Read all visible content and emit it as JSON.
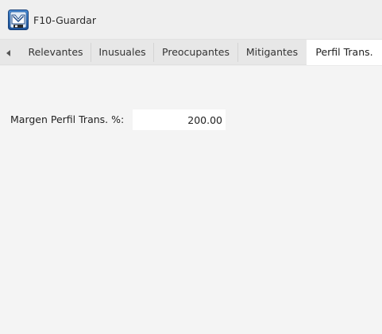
{
  "toolbar": {
    "save_label": "F10-Guardar",
    "save_icon": "save-icon"
  },
  "tabs": {
    "scroll_left_icon": "triangle-left-icon",
    "items": [
      {
        "label": "Relevantes"
      },
      {
        "label": "Inusuales"
      },
      {
        "label": "Preocupantes"
      },
      {
        "label": "Mitigantes"
      },
      {
        "label": "Perfil Trans."
      }
    ],
    "active": "Perfil Trans."
  },
  "panel": {
    "margen_label": "Margen Perfil Trans. %:",
    "margen_value": "200.00"
  },
  "colors": {
    "toolbar_bg": "#efefef",
    "tabbar_bg": "#e7e7e7",
    "active_tab_bg": "#ffffff",
    "panel_bg": "#f4f4f4",
    "icon_blue": "#1b5fa8"
  }
}
